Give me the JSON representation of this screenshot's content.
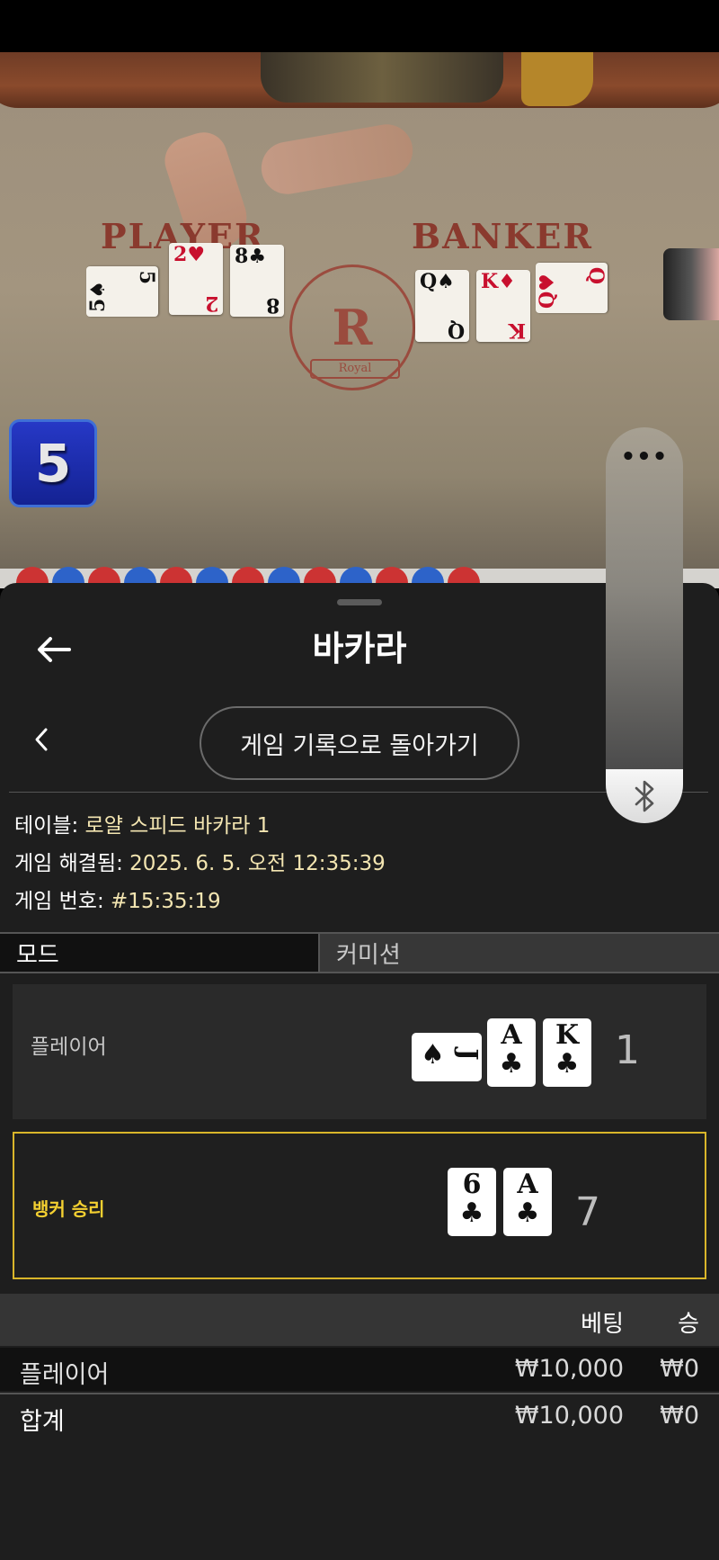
{
  "video": {
    "felt_player_label": "PLAYER",
    "felt_banker_label": "BANKER",
    "emblem_letter": "R",
    "emblem_ribbon": "Royal",
    "round_number": "5",
    "player_cards": [
      {
        "rank": "5",
        "suit": "♠",
        "color": "black"
      },
      {
        "rank": "2",
        "suit": "♥",
        "color": "red"
      },
      {
        "rank": "8",
        "suit": "♣",
        "color": "black"
      }
    ],
    "banker_cards": [
      {
        "rank": "Q",
        "suit": "♠",
        "color": "black"
      },
      {
        "rank": "K",
        "suit": "♦",
        "color": "red"
      },
      {
        "rank": "Q",
        "suit": "♥",
        "color": "red"
      }
    ]
  },
  "side_control": {
    "menu_icon": "more-dots-icon",
    "menu_glyph": "•••",
    "bluetooth_icon": "bluetooth-icon"
  },
  "sheet": {
    "title": "바카라",
    "history_button": "게임 기록으로 돌아가기",
    "table_label": "테이블: ",
    "table_value": "로얄 스피드 바카라 1",
    "resolved_label": "게임 해결됨: ",
    "resolved_value": "2025. 6. 5. 오전 12:35:39",
    "game_no_label": "게임 번호: ",
    "game_no_value": "#15:35:19",
    "mode_label": "모드",
    "commission_label": "커미션"
  },
  "results": {
    "player": {
      "label": "플레이어",
      "score": "1",
      "cards": [
        {
          "rank": "J",
          "suit": "♠",
          "sideways": true
        },
        {
          "rank": "A",
          "suit": "♣"
        },
        {
          "rank": "K",
          "suit": "♣"
        }
      ]
    },
    "banker": {
      "label": "뱅커 승리",
      "score": "7",
      "cards": [
        {
          "rank": "6",
          "suit": "♣"
        },
        {
          "rank": "A",
          "suit": "♣"
        }
      ]
    }
  },
  "bets": {
    "header_bet": "베팅",
    "header_win": "승",
    "rows": [
      {
        "label": "플레이어",
        "bet": "₩10,000",
        "win": "₩0"
      },
      {
        "label": "합계",
        "bet": "₩10,000",
        "win": "₩0"
      }
    ]
  },
  "colors": {
    "accent_gold": "#d9b52a",
    "banker_win_text": "#f4d031",
    "info_value": "#f3e5b1",
    "sheet_bg": "#1e1e1e"
  }
}
